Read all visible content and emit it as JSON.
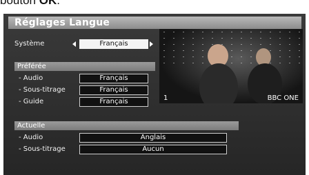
{
  "document_text": {
    "prefix": "bouton ",
    "bold": "OK",
    "suffix": "."
  },
  "menu": {
    "title": "Réglages Langue",
    "system": {
      "label": "Système",
      "value": "Français"
    },
    "preferred": {
      "header": "Préférée",
      "rows": [
        {
          "label": "- Audio",
          "value": "Français"
        },
        {
          "label": "- Sous-titrage",
          "value": "Français"
        },
        {
          "label": "- Guide",
          "value": "Français"
        }
      ]
    },
    "current": {
      "header": "Actuelle",
      "rows": [
        {
          "label": "- Audio",
          "value": "Anglais"
        },
        {
          "label": "- Sous-titrage",
          "value": "Aucun"
        }
      ]
    }
  },
  "preview": {
    "channel_number": "1",
    "channel_name": "BBC ONE"
  },
  "colors": {
    "accent_box": "#f4f4f4",
    "background": "#2f2f2f"
  }
}
